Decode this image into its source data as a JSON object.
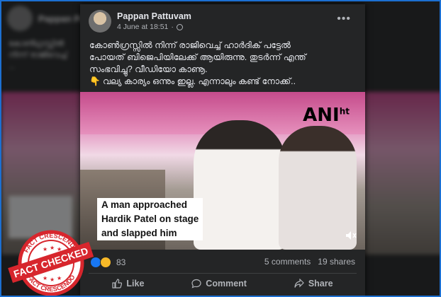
{
  "background": {
    "name": "Pappan Pa...",
    "sub": "4 June at 18:51",
    "text": "കോൺഗ്രസ്സിൽ നിന്ന് രാജിവെച്ച് ..."
  },
  "post": {
    "author": "Pappan Pattuvam",
    "timestamp": "4 June at 18:51",
    "more_icon": "more-horizontal-icon",
    "text_lines": [
      "കോൺഗ്രസ്സിൽ നിന്ന് രാജിവെച്ച് ഹാർദിക് പട്ടേൽ",
      "പോയത് ബിജെപിയിലേക്ക് ആയിരുന്നു. തുടർന്ന് എന്ത്",
      "സംഭവിച്ചു? വീഡിയോ കാണൂ.",
      "👇 വല്യ കാര്യം ഒന്നും ഇല്ല. എന്നാലും കണ്ട് നോക്ക്.."
    ]
  },
  "video": {
    "logo": "ANI",
    "logo_sup": "ht",
    "caption_lines": [
      "A man approached",
      "Hardik Patel on stage",
      "and slapped him"
    ],
    "mute_icon": "volume-muted-icon"
  },
  "stats": {
    "reaction_count": "83",
    "comments": "5 comments",
    "shares": "19 shares"
  },
  "actions": {
    "like": "Like",
    "comment": "Comment",
    "share": "Share"
  },
  "stamp": {
    "top": "FACT CRESCENDO",
    "middle": "FACT CHECKED",
    "bottom": "FACT CRESCENDO"
  },
  "colors": {
    "accent": "#1c6fd1",
    "card": "#242526",
    "stamp_red": "#d7262d"
  }
}
